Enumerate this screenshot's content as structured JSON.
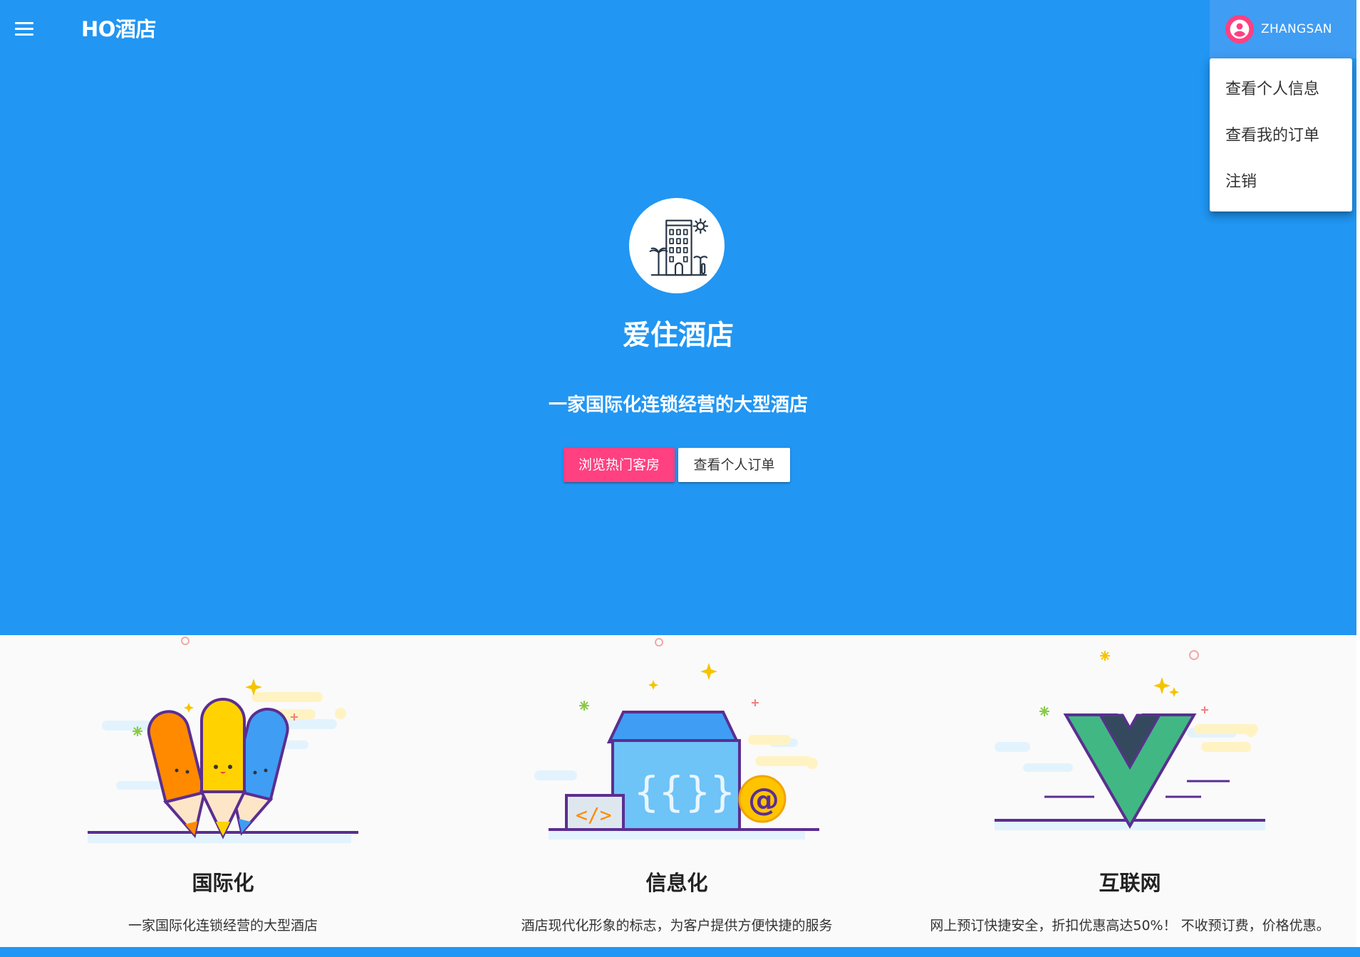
{
  "appbar": {
    "brand": "HO酒店",
    "user_name": "ZHANGSAN",
    "menu_icon": "hamburger-menu-icon",
    "avatar_icon": "account-circle-icon"
  },
  "dropdown": {
    "items": [
      {
        "label": "查看个人信息"
      },
      {
        "label": "查看我的订单"
      },
      {
        "label": "注销"
      }
    ]
  },
  "hero": {
    "logo_icon": "hotel-building-icon",
    "title": "爱住酒店",
    "subtitle": "一家国际化连锁经营的大型酒店",
    "primary_button": "浏览热门客房",
    "secondary_button": "查看个人订单"
  },
  "features": [
    {
      "illustration": "pencils-illustration",
      "title": "国际化",
      "desc": "一家国际化连锁经营的大型酒店"
    },
    {
      "illustration": "code-box-illustration",
      "title": "信息化",
      "desc": "酒店现代化形象的标志，为客户提供方便快捷的服务"
    },
    {
      "illustration": "vue-logo-illustration",
      "title": "互联网",
      "desc": "网上预订快捷安全，折扣优惠高达50%！ 不收预订费，价格优惠。"
    }
  ],
  "colors": {
    "primary": "#2196F3",
    "accent": "#ff4081",
    "feature_background": "#fafafa"
  }
}
